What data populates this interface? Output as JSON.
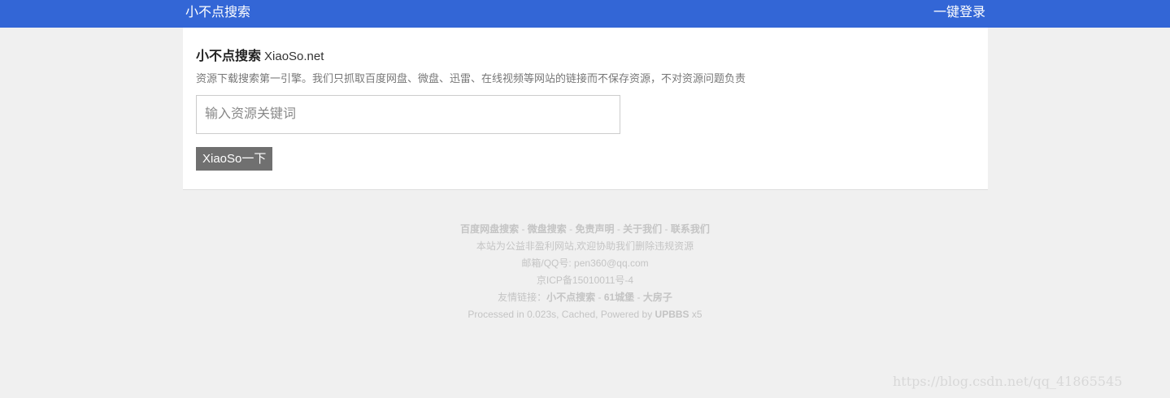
{
  "header": {
    "brand": "小不点搜索",
    "login_label": "一键登录"
  },
  "main": {
    "title_name": "小不点搜索",
    "title_domain": "XiaoSo.net",
    "tagline": "资源下载搜索第一引擎。我们只抓取百度网盘、微盘、迅雷、在线视频等网站的链接而不保存资源，不对资源问题负责",
    "search_placeholder": "输入资源关键词",
    "search_button": "XiaoSo一下"
  },
  "footer": {
    "links": [
      "百度网盘搜索",
      "微盘搜索",
      "免责声明",
      "关于我们",
      "联系我们"
    ],
    "separator": " - ",
    "notice": "本站为公益非盈利网站,欢迎协助我们删除违规资源",
    "email": "邮箱/QQ号: pen360@qq.com",
    "icp": "京ICP备15010011号-4",
    "friends_label": "友情链接：",
    "friend_links": [
      "小不点搜索",
      "61城堡",
      "大房子"
    ],
    "processed_text": "Processed in 0.023s, Cached, Powered by ",
    "powered_link": "UPBBS",
    "powered_suffix": " x5"
  },
  "watermark": "https://blog.csdn.net/qq_41865545"
}
